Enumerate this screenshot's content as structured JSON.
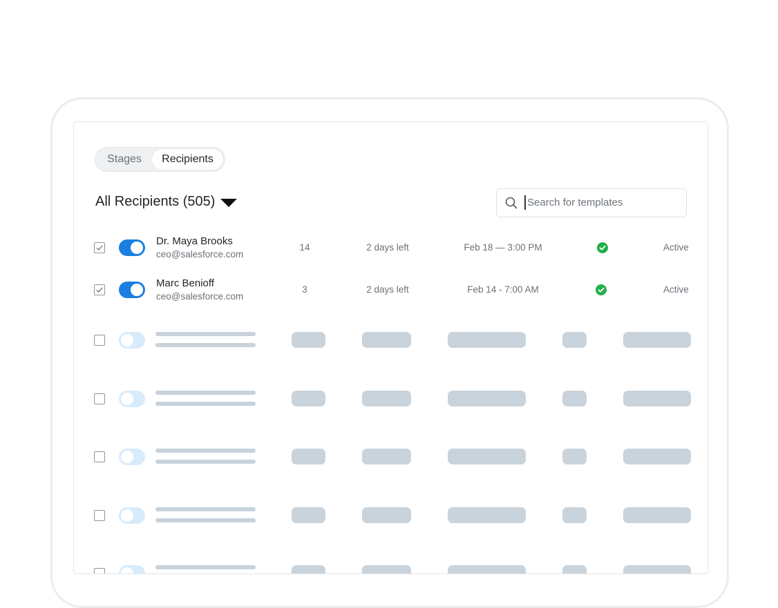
{
  "tabs": [
    {
      "label": "Stages",
      "active": false
    },
    {
      "label": "Recipients",
      "active": true
    }
  ],
  "header": {
    "filter_label": "All Recipients (505)"
  },
  "search": {
    "placeholder": "Search for templates",
    "value": ""
  },
  "rows": [
    {
      "checked": true,
      "enabled": true,
      "name": "Dr. Maya Brooks",
      "email": "ceo@salesforce.com",
      "count": "14",
      "remaining": "2 days left",
      "datetime": "Feb 18 — 3:00 PM",
      "status_icon": "check-circle-icon",
      "status": "Active"
    },
    {
      "checked": true,
      "enabled": true,
      "name": "Marc Benioff",
      "email": "ceo@salesforce.com",
      "count": "3",
      "remaining": "2 days left",
      "datetime": "Feb 14 - 7:00 AM",
      "status_icon": "check-circle-icon",
      "status": "Active"
    }
  ],
  "colors": {
    "toggle_on": "#1a7fe0",
    "toggle_off": "#d8ebfb",
    "skeleton": "#c9d3dc",
    "status_green": "#22b04b"
  }
}
